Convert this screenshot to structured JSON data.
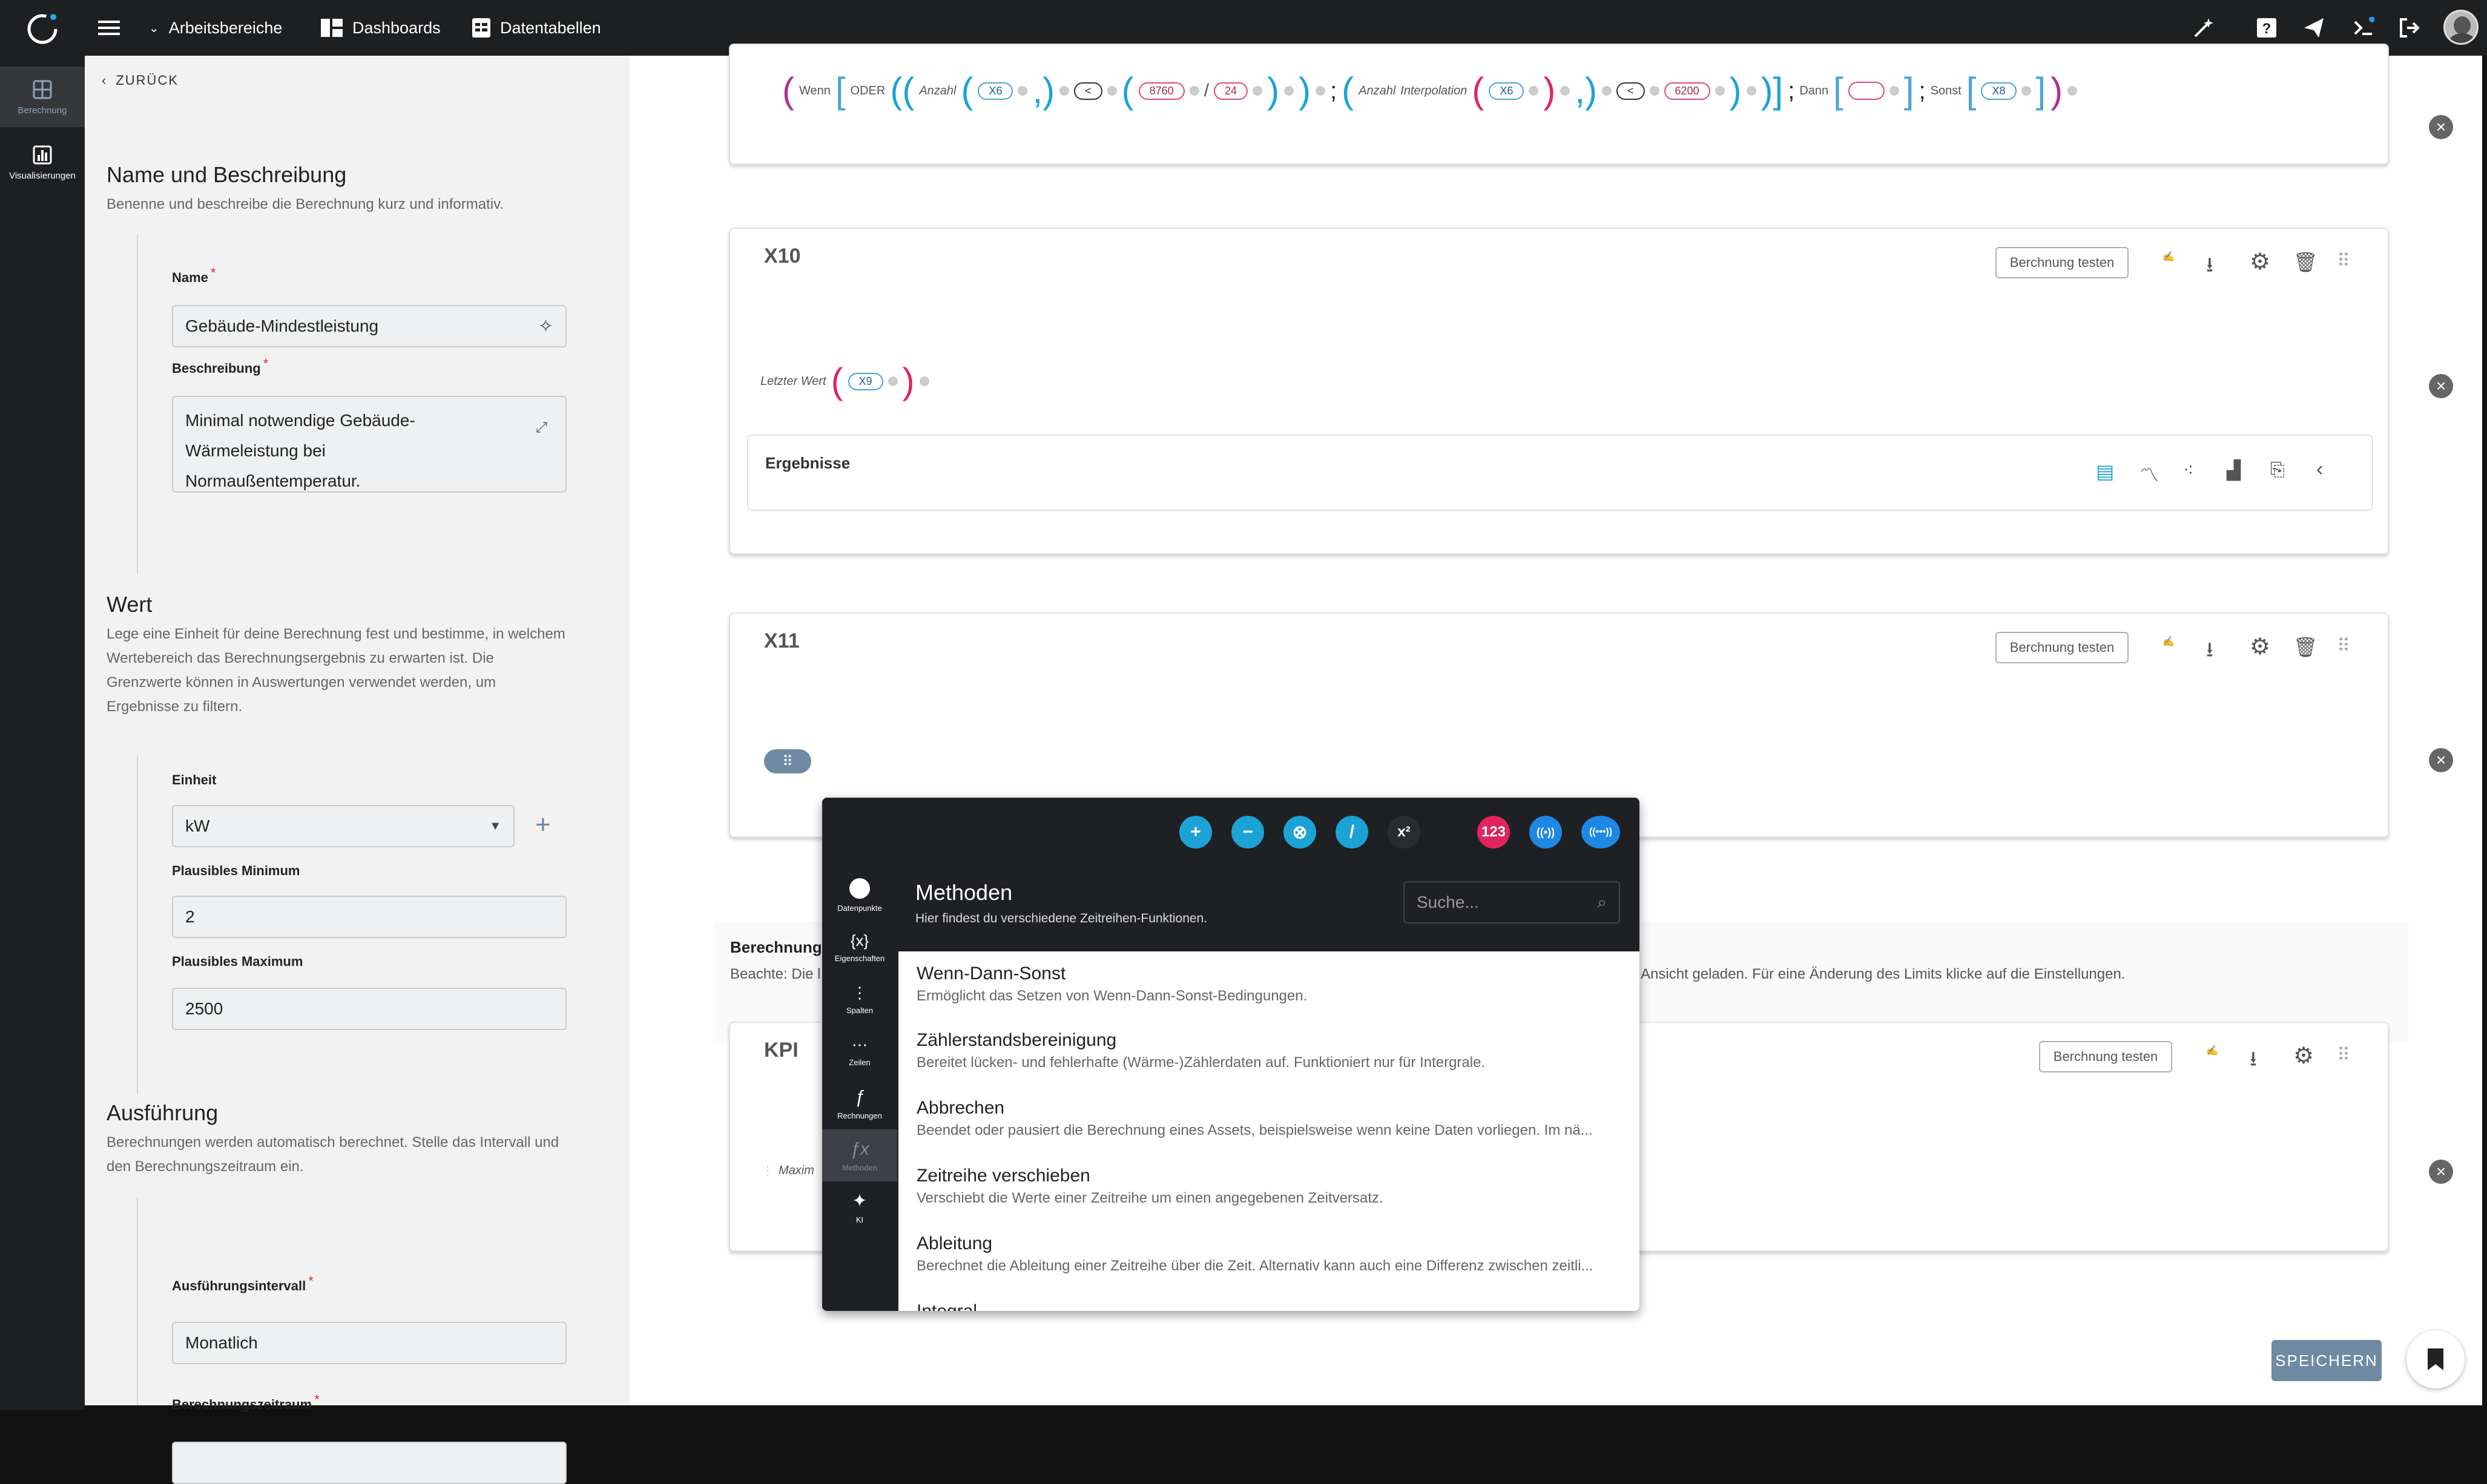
{
  "topbar": {
    "workspaces": "Arbeitsbereiche",
    "dashboards": "Dashboards",
    "datatables": "Datentabellen"
  },
  "rail": [
    {
      "label": "Berechnung"
    },
    {
      "label": "Visualisierungen"
    }
  ],
  "left": {
    "back": "ZURÜCK",
    "section1": {
      "title": "Name und Beschreibung",
      "subtitle": "Benenne und beschreibe die Berechnung kurz und informativ.",
      "name_label": "Name",
      "name_value": "Gebäude-Mindestleistung",
      "desc_label": "Beschreibung",
      "desc_value_1": "Minimal notwendige Gebäude-",
      "desc_value_2": "Wärmeleistung bei",
      "desc_value_3": "Normaußentemperatur."
    },
    "section2": {
      "title": "Wert",
      "subtitle_1": "Lege eine Einheit für deine Berechnung fest und bestimme, in welchem",
      "subtitle_2": "Wertebereich das Berechnungsergebnis zu erwarten ist. Die",
      "subtitle_3": "Grenzwerte können in Auswertungen verwendet werden, um",
      "subtitle_4": "Ergebnisse zu filtern.",
      "unit_label": "Einheit",
      "unit_value": "kW",
      "min_label": "Plausibles Minimum",
      "min_value": "2",
      "max_label": "Plausibles Maximum",
      "max_value": "2500"
    },
    "section3": {
      "title": "Ausführung",
      "subtitle_1": "Berechnungen werden automatisch berechnet. Stelle das Intervall und",
      "subtitle_2": "den Berechnungszeitraum ein.",
      "interval_label": "Ausführungsintervall",
      "interval_value": "Monatlich",
      "period_label": "Berechnungszeitraum"
    }
  },
  "main": {
    "formula1": {
      "wenn": "Wenn",
      "oder": "ODER",
      "anzahl": "Anzahl",
      "x6": "X6",
      "lt": "<",
      "v8760": "8760",
      "slash": "/",
      "v24": "24",
      "semi": ";",
      "anzahl2": "Anzahl",
      "interpolation": "Interpolation",
      "x6b": "X6",
      "lt2": "<",
      "v6200": "6200",
      "dann": "Dann",
      "sonst": "Sonst",
      "x8": "X8"
    },
    "x10": {
      "title": "X10",
      "test": "Berchnung testen",
      "letzter": "Letzter Wert",
      "x9": "X9",
      "results": "Ergebnisse"
    },
    "x11": {
      "title": "X11",
      "test": "Berchnung testen"
    },
    "berechnung": {
      "title": "Berechnung",
      "note_left": "Beachte: Die l",
      "note_right": "Ansicht geladen. Für eine Änderung des Limits klicke auf die Einstellungen."
    },
    "kpi": {
      "title": "KPI",
      "test": "Berchnung testen",
      "maxim": "Maxim"
    },
    "save": "SPEICHERN"
  },
  "popup": {
    "title": "Methoden",
    "subtitle": "Hier findest du verschiedene Zeitreihen-Funktionen.",
    "search_placeholder": "Suche...",
    "ops": [
      "+",
      "−",
      "⊗",
      "/",
      "x²",
      "123",
      "((•))",
      "((•••))"
    ],
    "rail": [
      "Datenpunkte",
      "Eigenschaften",
      "Spalten",
      "Zeilen",
      "Rechnungen",
      "Methoden",
      "KI"
    ],
    "items": [
      {
        "title": "Wenn-Dann-Sonst",
        "desc": "Ermöglicht das Setzen von Wenn-Dann-Sonst-Bedingungen."
      },
      {
        "title": "Zählerstandsbereinigung",
        "desc": "Bereitet lücken- und fehlerhafte (Wärme-)Zählerdaten auf. Funktioniert nur für Intergrale."
      },
      {
        "title": "Abbrechen",
        "desc": "Beendet oder pausiert die Berechnung eines Assets, beispielsweise wenn keine Daten vorliegen. Im nä..."
      },
      {
        "title": "Zeitreihe verschieben",
        "desc": "Verschiebt die Werte einer Zeitreihe um einen angegebenen Zeitversatz."
      },
      {
        "title": "Ableitung",
        "desc": "Berechnet die Ableitung einer Zeitreihe über die Zeit. Alternativ kann auch eine Differenz zwischen zeitli..."
      },
      {
        "title": "Integral",
        "desc": ""
      }
    ]
  },
  "colors": {
    "topbar": "#1e1f21",
    "accent_blue": "#1ba3d6",
    "pink": "#e0245e",
    "save": "#6f8aa3"
  }
}
